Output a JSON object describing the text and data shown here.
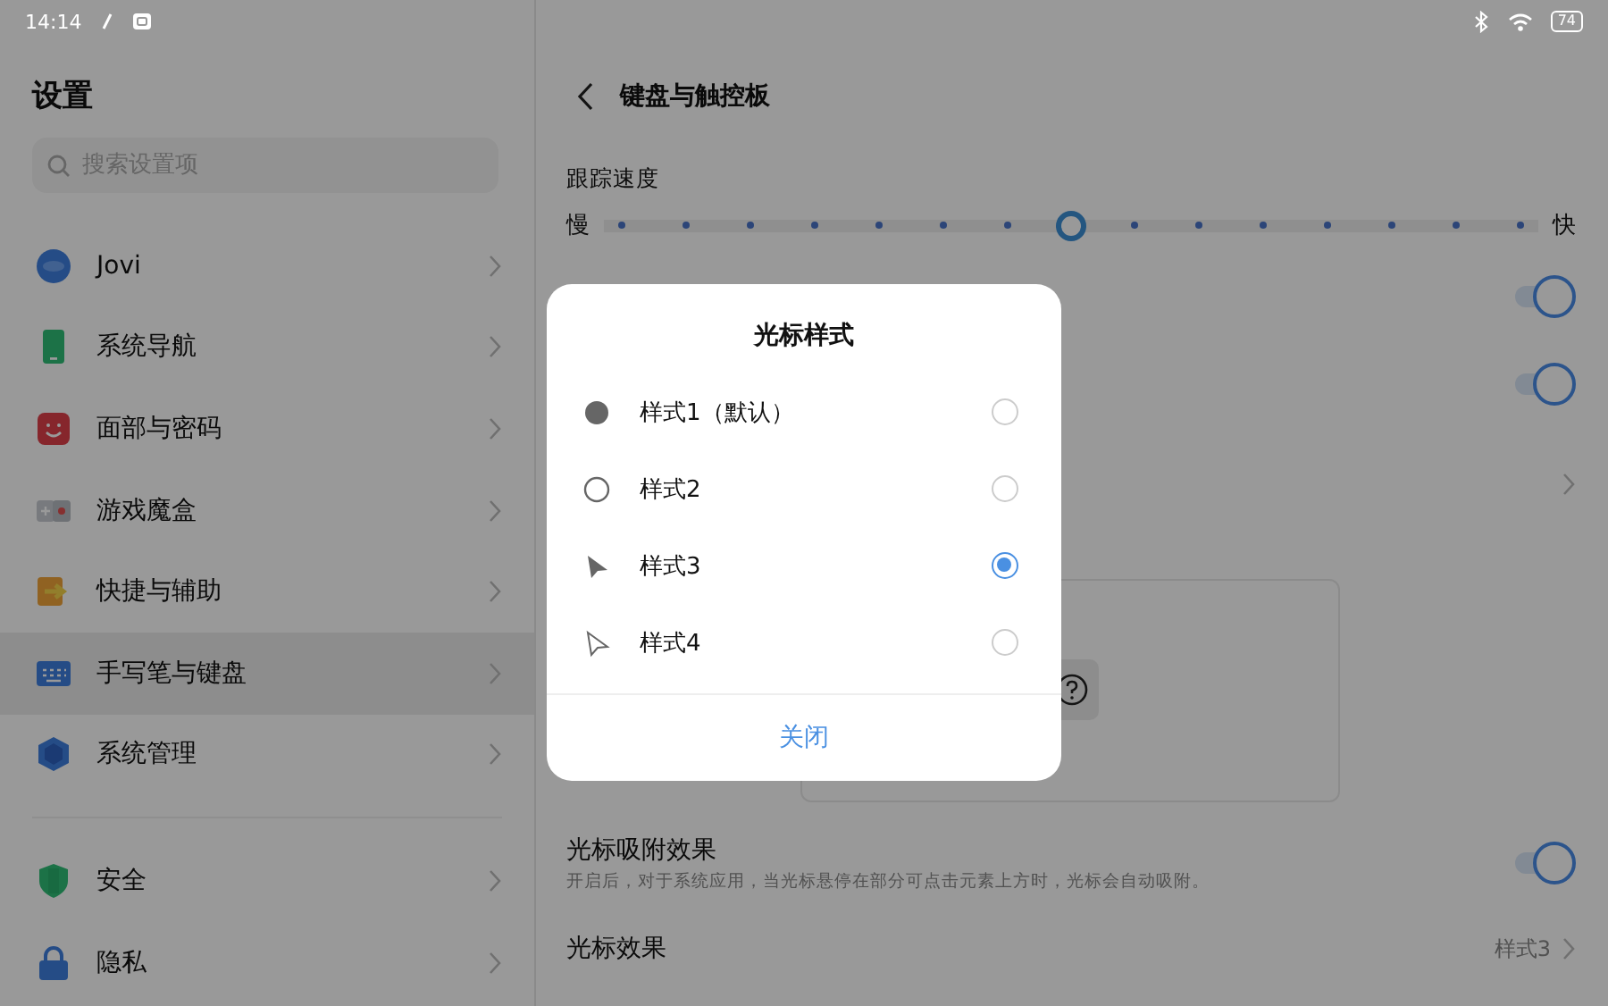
{
  "status_bar": {
    "time": "14:14",
    "battery": "74"
  },
  "sidebar": {
    "title": "设置",
    "search": {
      "placeholder": "搜索设置项"
    },
    "groups": [
      {
        "items": [
          {
            "label": "Jovi",
            "selected": false
          },
          {
            "label": "系统导航",
            "selected": false
          },
          {
            "label": "面部与密码",
            "selected": false
          },
          {
            "label": "游戏魔盒",
            "selected": false
          },
          {
            "label": "快捷与辅助",
            "selected": false
          },
          {
            "label": "手写笔与键盘",
            "selected": true
          },
          {
            "label": "系统管理",
            "selected": false
          }
        ]
      },
      {
        "items": [
          {
            "label": "安全",
            "selected": false
          },
          {
            "label": "隐私",
            "selected": false
          }
        ]
      }
    ]
  },
  "detail": {
    "title": "键盘与触控板",
    "tracking_speed": {
      "label": "跟踪速度",
      "min_label": "慢",
      "max_label": "快",
      "level": 0.5
    },
    "rows": [
      {
        "kind": "toggle",
        "on": true
      },
      {
        "kind": "toggle",
        "on": true
      },
      {
        "kind": "link"
      },
      {
        "kind": "preview"
      },
      {
        "kind": "toggle",
        "label": "光标吸附效果",
        "description": "开启后，对于系统应用，当光标悬停在部分可点击元素上方时，光标会自动吸附。",
        "on": true
      },
      {
        "kind": "link",
        "label": "光标效果",
        "value": "样式3"
      }
    ]
  },
  "dialog": {
    "title": "光标样式",
    "options": [
      {
        "kind": "dot",
        "label": "样式1（默认）",
        "selected": false
      },
      {
        "kind": "ring",
        "label": "样式2",
        "selected": false
      },
      {
        "kind": "arrow",
        "label": "样式3",
        "selected": true
      },
      {
        "kind": "outline-arrow",
        "label": "样式4",
        "selected": false
      }
    ],
    "close": "关闭"
  }
}
